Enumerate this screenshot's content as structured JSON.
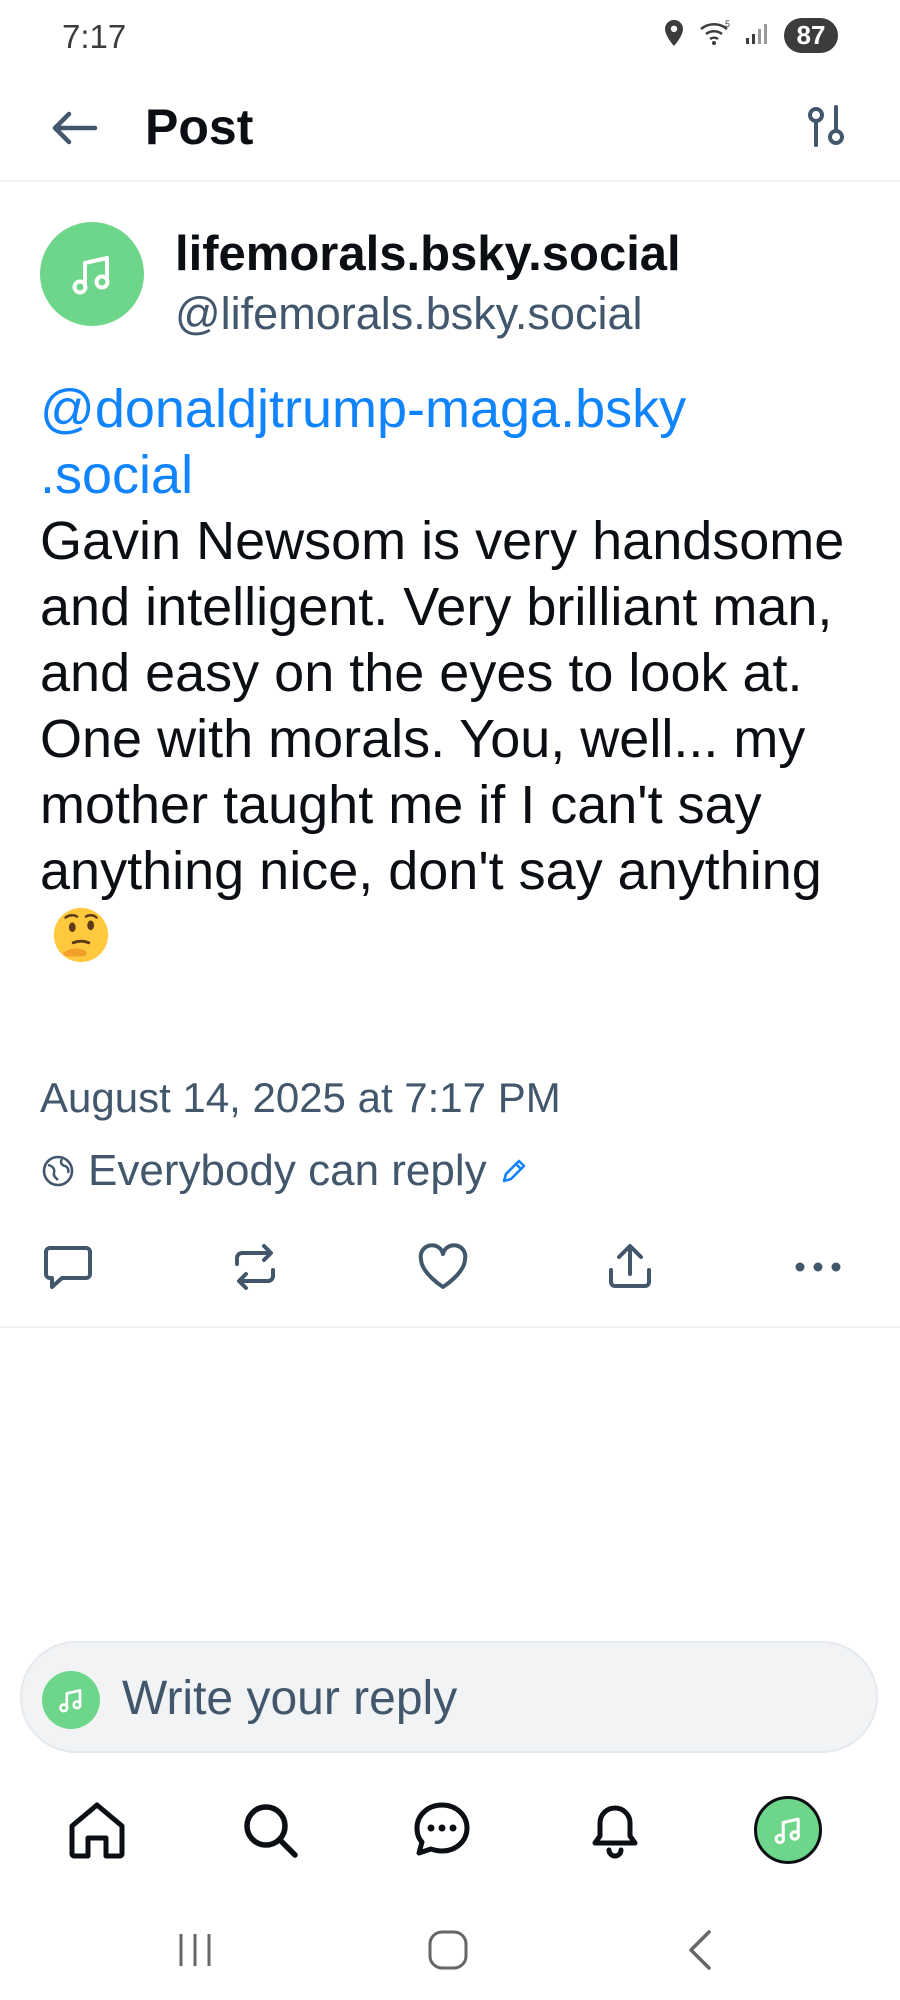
{
  "status_bar": {
    "time": "7:17",
    "battery": "87",
    "icons": [
      "location-icon",
      "wifi-icon",
      "signal-icon",
      "battery-icon"
    ]
  },
  "header": {
    "title": "Post",
    "back_icon": "arrow-left-icon",
    "filter_icon": "sliders-icon"
  },
  "post": {
    "author_name": "lifemorals.bsky.social",
    "author_handle": "@lifemorals.bsky.social",
    "mention": "@donaldjtrump-maga.bsky\n.social",
    "text": "Gavin Newsom is very handsome and intelligent. Very brilliant man, and easy on the eyes to look at. One with morals. You, well... my mother taught me if I can't say anything nice, don't say anything",
    "emoji": "thinking-face-emoji",
    "timestamp": "August 14, 2025 at 7:17 PM",
    "reply_setting": "Everybody can reply"
  },
  "actions": [
    "reply-icon",
    "repost-icon",
    "like-icon",
    "share-icon",
    "more-icon"
  ],
  "composer": {
    "placeholder": "Write your reply"
  },
  "bottom_nav": [
    "home-icon",
    "search-icon",
    "chat-icon",
    "bell-icon",
    "profile-avatar"
  ],
  "colors": {
    "accent": "#1083fe",
    "avatar": "#6ed68a",
    "muted_text": "#42576c",
    "text": "#0b0f14"
  }
}
